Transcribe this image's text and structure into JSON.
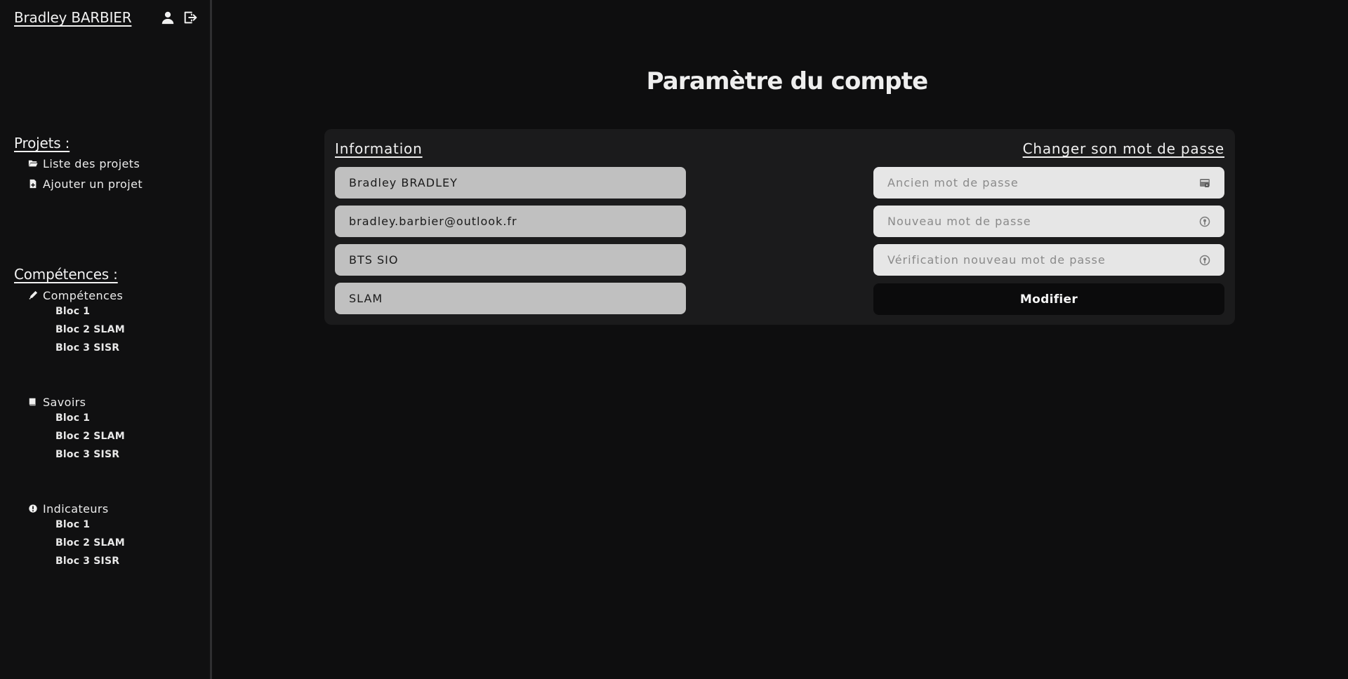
{
  "user": {
    "name": "Bradley BARBIER"
  },
  "sidebar": {
    "projets": {
      "title": "Projets :",
      "items": [
        {
          "label": "Liste des projets",
          "icon": "folder-open-icon"
        },
        {
          "label": "Ajouter un projet",
          "icon": "file-add-icon"
        }
      ]
    },
    "competences": {
      "title": "Compétences :",
      "groups": [
        {
          "label": "Compétences",
          "icon": "pen-icon",
          "subs": [
            "Bloc 1",
            "Bloc 2 SLAM",
            "Bloc 3 SISR"
          ]
        },
        {
          "label": "Savoirs",
          "icon": "book-icon",
          "subs": [
            "Bloc 1",
            "Bloc 2 SLAM",
            "Bloc 3 SISR"
          ]
        },
        {
          "label": "Indicateurs",
          "icon": "exclamation-circle-icon",
          "subs": [
            "Bloc 1",
            "Bloc 2 SLAM",
            "Bloc 3 SISR"
          ]
        }
      ]
    }
  },
  "main": {
    "title": "Paramètre du compte",
    "info": {
      "heading": "Information",
      "fields": [
        "Bradley BRADLEY",
        "bradley.barbier@outlook.fr",
        "BTS SIO",
        "SLAM"
      ]
    },
    "password": {
      "heading": "Changer son mot de passe",
      "placeholders": [
        "Ancien mot de passe",
        "Nouveau mot de passe",
        "Vérification nouveau mot de passe"
      ],
      "submit": "Modifier"
    }
  },
  "colors": {
    "background": "#0e0e0f",
    "sidebar": "#101011",
    "card": "#1b1b1c",
    "info_field": "#c0c0c0",
    "password_field": "#e6e6e6",
    "button": "#0b0b0c"
  }
}
